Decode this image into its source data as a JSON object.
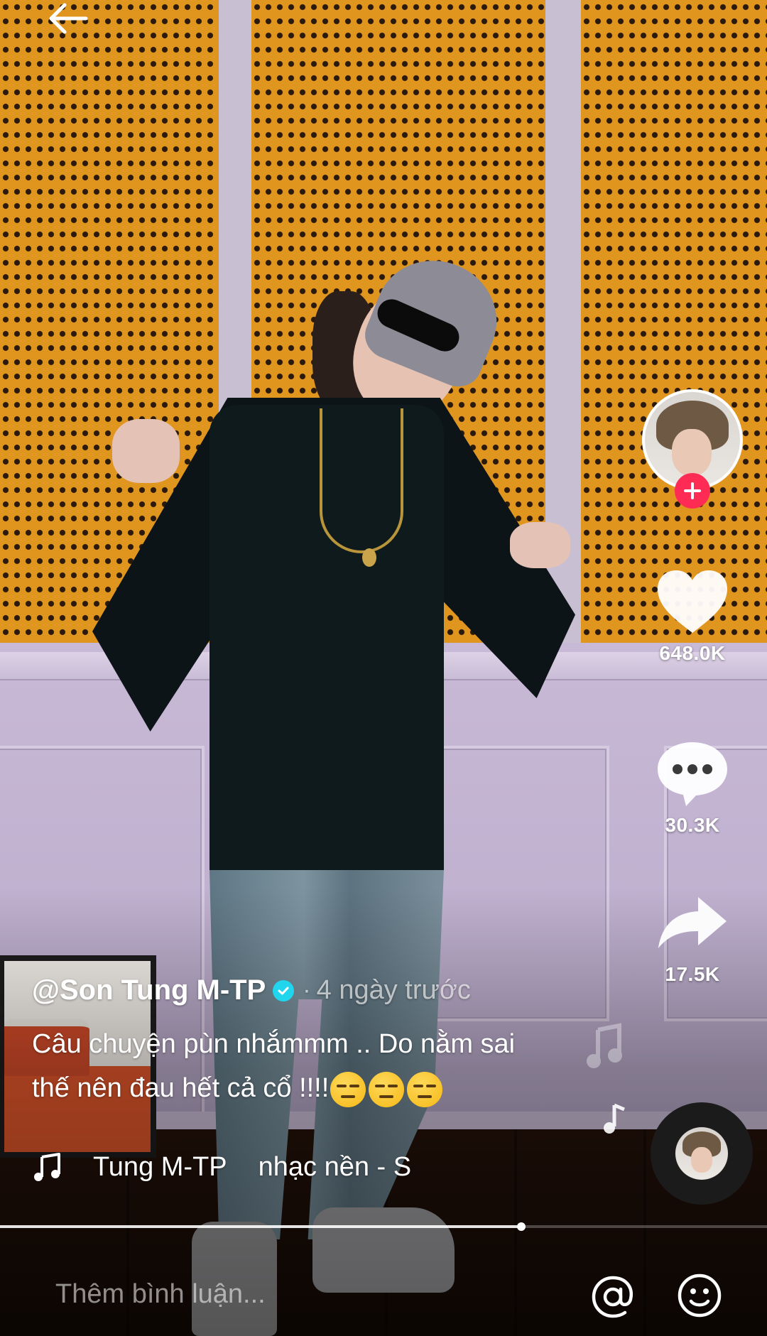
{
  "video": {
    "progress_fraction": 0.68
  },
  "author": {
    "username": "@Son Tung M-TP",
    "verified": true,
    "posted_ago": "4 ngày trước",
    "avatar_icon": "profile-photo"
  },
  "caption": {
    "text": "Câu chuyện pùn nhắmmm .. Do nằm sai thế nên đau hết cả cổ !!!!",
    "emoji_count": 3,
    "emoji_icon": "unamused-face-icon"
  },
  "sound": {
    "parts": [
      "Tung M-TP",
      "nhạc nền - S"
    ]
  },
  "actions": {
    "like_count": "648.0K",
    "comment_count": "30.3K",
    "share_count": "17.5K"
  },
  "comment_bar": {
    "placeholder": "Thêm bình luận..."
  },
  "colors": {
    "follow_accent": "#fe2c55",
    "verified_badge": "#20d5ec"
  }
}
